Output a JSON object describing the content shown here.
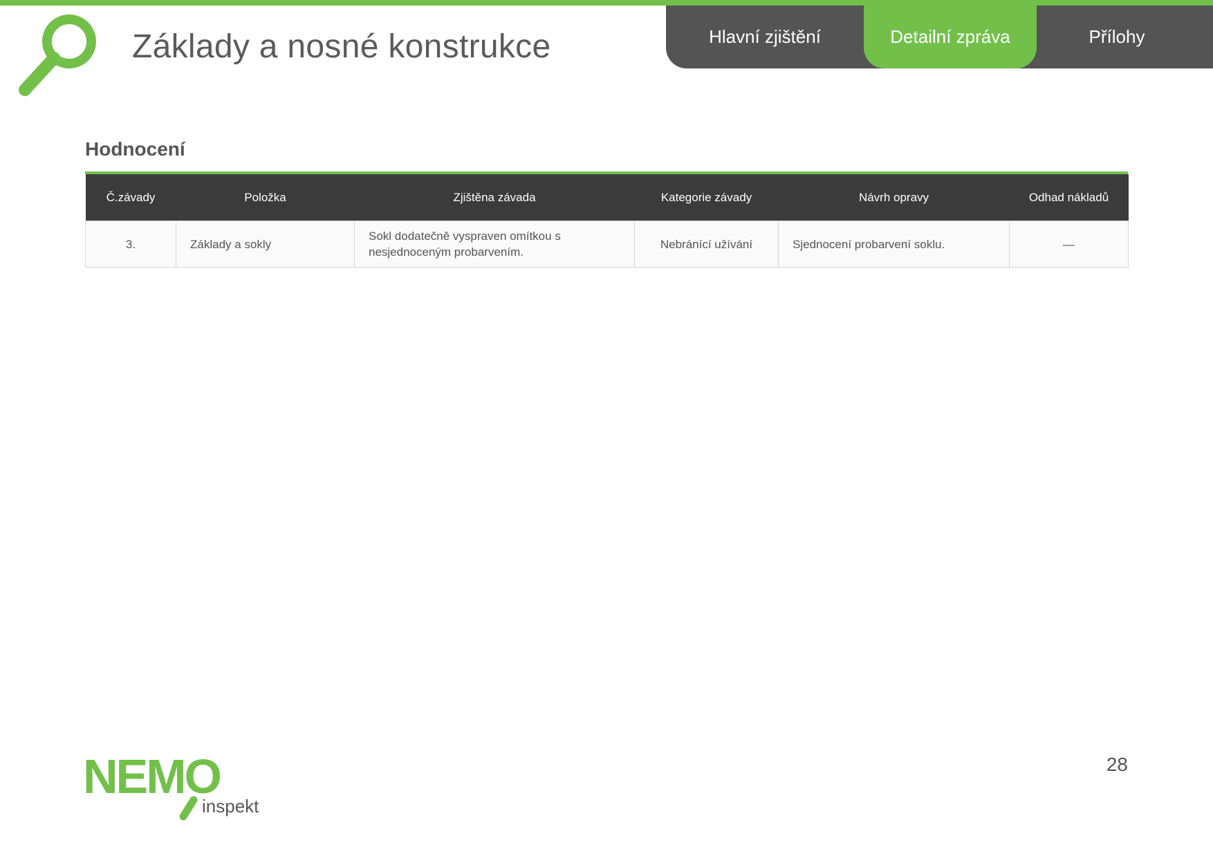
{
  "header": {
    "title": "Základy a nosné konstrukce",
    "brand_color": "#72c04a",
    "logo_icon": "magnifier-icon"
  },
  "nav": {
    "tabs": [
      {
        "label": "Hlavní zjištění",
        "active": false
      },
      {
        "label": "Detailní zpráva",
        "active": true
      },
      {
        "label": "Přílohy",
        "active": false
      }
    ]
  },
  "section": {
    "heading": "Hodnocení"
  },
  "table": {
    "columns": [
      "Č.závady",
      "Položka",
      "Zjištěna závada",
      "Kategorie závady",
      "Návrh opravy",
      "Odhad nákladů"
    ],
    "rows": [
      {
        "number": "3.",
        "item": "Základy a sokly",
        "defect": "Sokl dodatečně vyspraven omítkou s nesjednoceným probarvením.",
        "category": "Nebránící užívání",
        "repair": "Sjednocení probarvení soklu.",
        "cost": "—"
      }
    ]
  },
  "footer": {
    "logo_text": "NEMO",
    "logo_subtext": "inspekt",
    "page_number": "28"
  }
}
